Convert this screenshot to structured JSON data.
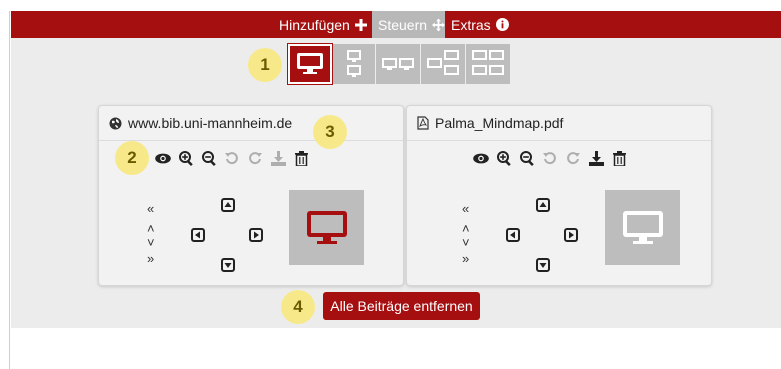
{
  "nav": {
    "add_label": "Hinzufügen",
    "control_label": "Steuern",
    "extras_label": "Extras"
  },
  "badges": {
    "b1": "1",
    "b2": "2",
    "b3": "3",
    "b4": "4"
  },
  "layouts": [
    {
      "name": "single-screen",
      "selected": true
    },
    {
      "name": "two-stacked",
      "selected": false
    },
    {
      "name": "two-side-by-side",
      "selected": false
    },
    {
      "name": "three-screens",
      "selected": false
    },
    {
      "name": "four-screens",
      "selected": false
    }
  ],
  "panels": [
    {
      "title": "www.bib.uni-mannheim.de",
      "type_icon": "globe-icon",
      "preview_active": true
    },
    {
      "title": "Palma_Mindmap.pdf",
      "type_icon": "pdf-file-icon",
      "preview_active": false
    }
  ],
  "remove_all_label": "Alle Beiträge entfernen",
  "colors": {
    "accent": "#a50f10",
    "inactive": "#bdbdbd",
    "background": "#ececec",
    "badge": "#f7e98a"
  }
}
